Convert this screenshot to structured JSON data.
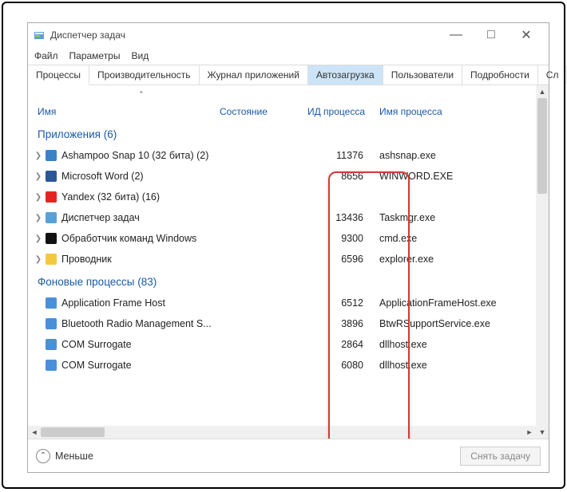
{
  "window": {
    "title": "Диспетчер задач",
    "minimize": "—",
    "maximize": "□",
    "close": "✕"
  },
  "menu": {
    "file": "Файл",
    "options": "Параметры",
    "view": "Вид"
  },
  "tabs": {
    "processes": "Процессы",
    "performance": "Производительность",
    "apphistory": "Журнал приложений",
    "startup": "Автозагрузка",
    "users": "Пользователи",
    "details": "Подробности",
    "services": "Сл"
  },
  "columns": {
    "name": "Имя",
    "status": "Состояние",
    "pid": "ИД процесса",
    "pname": "Имя процесса"
  },
  "groups": {
    "apps": "Приложения (6)",
    "bg": "Фоновые процессы (83)"
  },
  "apps": [
    {
      "name": "Ashampoo Snap 10 (32 бита) (2)",
      "pid": "11376",
      "pname": "ashsnap.exe",
      "icon": "#3b82c4",
      "exp": true
    },
    {
      "name": "Microsoft Word (2)",
      "pid": "8656",
      "pname": "WINWORD.EXE",
      "icon": "#2b579a",
      "exp": true
    },
    {
      "name": "Yandex (32 бита) (16)",
      "pid": "",
      "pname": "",
      "icon": "#e52620",
      "exp": true
    },
    {
      "name": "Диспетчер задач",
      "pid": "13436",
      "pname": "Taskmgr.exe",
      "icon": "#5aa0d8",
      "exp": true
    },
    {
      "name": "Обработчик команд Windows",
      "pid": "9300",
      "pname": "cmd.exe",
      "icon": "#111",
      "exp": true
    },
    {
      "name": "Проводник",
      "pid": "6596",
      "pname": "explorer.exe",
      "icon": "#f5c842",
      "exp": true
    }
  ],
  "bg": [
    {
      "name": "Application Frame Host",
      "pid": "6512",
      "pname": "ApplicationFrameHost.exe",
      "icon": "#4a90d9"
    },
    {
      "name": "Bluetooth Radio Management S...",
      "pid": "3896",
      "pname": "BtwRSupportService.exe",
      "icon": "#4a90d9"
    },
    {
      "name": "COM Surrogate",
      "pid": "2864",
      "pname": "dllhost.exe",
      "icon": "#4a90d9"
    },
    {
      "name": "COM Surrogate",
      "pid": "6080",
      "pname": "dllhost.exe",
      "icon": "#4a90d9"
    }
  ],
  "footer": {
    "fewer": "Меньше",
    "endtask": "Снять задачу"
  }
}
